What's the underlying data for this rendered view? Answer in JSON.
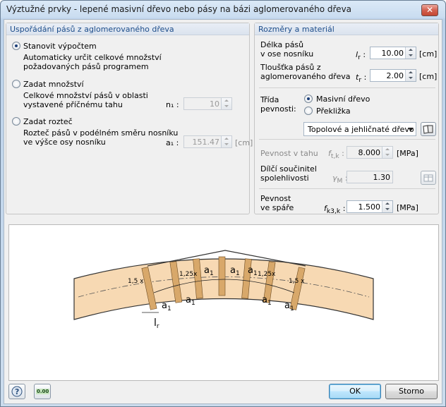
{
  "window": {
    "title": "Výztužné prvky - lepené masivní dřevo nebo pásy na bázi aglomerovaného dřeva",
    "close_glyph": "✕"
  },
  "left_panel": {
    "header": "Uspořádání pásů z aglomerovaného dřeva",
    "opt1": {
      "label": "Stanovit výpočtem",
      "desc1": "Automaticky určit celkové množství",
      "desc2": "požadovaných pásů programem",
      "selected": true
    },
    "opt2": {
      "label": "Zadat množství",
      "desc1": "Celkové množství pásů v oblasti",
      "desc2": "vystavené příčnému tahu",
      "sym": "n₁ :",
      "value": "10"
    },
    "opt3": {
      "label": "Zadat rozteč",
      "desc1": "Rozteč pásů v podélném směru nosníku",
      "desc2": "ve výšce osy nosníku",
      "sym": "a₁ :",
      "value": "151.47",
      "unit": "[cm]"
    }
  },
  "right_panel": {
    "header": "Rozměry a materiál",
    "length": {
      "l1": "Délka pásů",
      "l2": "v ose nosníku",
      "sym": "l",
      "sub": "r",
      "value": "10.00",
      "unit": "[cm]"
    },
    "thick": {
      "l1": "Tloušťka pásů z",
      "l2": "aglomerovaného dřeva",
      "sym": "t",
      "sub": "r",
      "value": "2.00",
      "unit": "[cm]"
    },
    "cls": {
      "l1": "Třída",
      "l2": "pevnosti:",
      "opt_a": "Masivní dřevo",
      "opt_b": "Překližka"
    },
    "material": "Topolové a jehličnaté dřevo",
    "ft": {
      "label": "Pevnost v tahu",
      "sym": "f",
      "sub": "t,k",
      "value": "8.000",
      "unit": "[MPa]"
    },
    "gm": {
      "l1": "Dílčí součinitel",
      "l2": "spolehlivosti",
      "sym": "γ",
      "sub": "M",
      "value": "1.30"
    },
    "fk3": {
      "l1": "Pevnost",
      "l2": "ve spáře",
      "sym": "f",
      "sub": "k3,k",
      "value": "1.500",
      "unit": "[MPa]"
    }
  },
  "diagram": {
    "a": "a",
    "one": "1",
    "l15": "1,5 x",
    "l125": "1,25x",
    "lr": "l",
    "lr_sub": "r"
  },
  "buttons": {
    "ok": "OK",
    "cancel": "Storno",
    "units_icon_text": "0.00"
  }
}
